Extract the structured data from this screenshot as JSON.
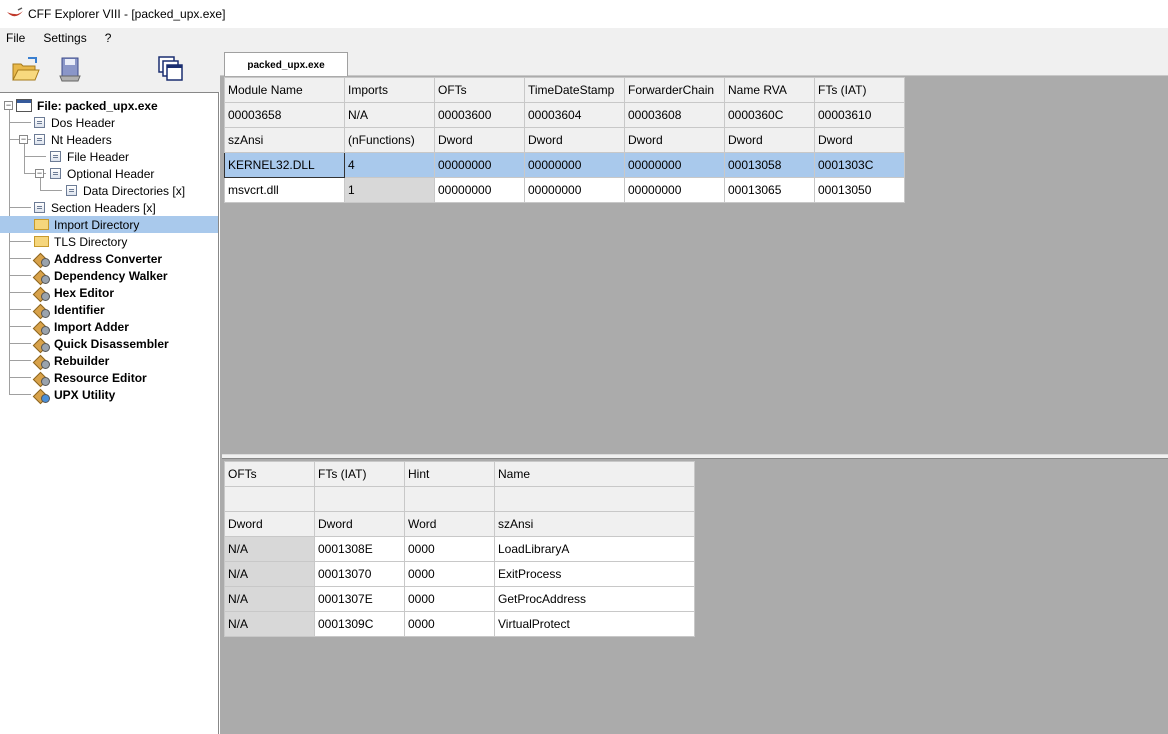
{
  "window": {
    "title": "CFF Explorer VIII - [packed_upx.exe]"
  },
  "menu": [
    "File",
    "Settings",
    "?"
  ],
  "tab": {
    "label": "packed_upx.exe"
  },
  "tree": [
    {
      "label": "File: packed_upx.exe",
      "bold": true,
      "icon": "file-icon",
      "indent": 0
    },
    {
      "label": "Dos Header",
      "icon": "doc-icon",
      "indent": 1
    },
    {
      "label": "Nt Headers",
      "icon": "doc-icon",
      "indent": 1
    },
    {
      "label": "File Header",
      "icon": "doc-icon",
      "indent": 2
    },
    {
      "label": "Optional Header",
      "icon": "doc-icon",
      "indent": 2
    },
    {
      "label": "Data Directories [x]",
      "icon": "doc-icon",
      "indent": 3
    },
    {
      "label": "Section Headers [x]",
      "icon": "doc-icon",
      "indent": 1
    },
    {
      "label": "Import Directory",
      "icon": "folder-icon",
      "indent": 1,
      "selected": true
    },
    {
      "label": "TLS Directory",
      "icon": "folder-icon",
      "indent": 1
    },
    {
      "label": "Address Converter",
      "icon": "tool-icon",
      "indent": 1,
      "bold": true
    },
    {
      "label": "Dependency Walker",
      "icon": "tool-icon",
      "indent": 1,
      "bold": true
    },
    {
      "label": "Hex Editor",
      "icon": "tool-icon",
      "indent": 1,
      "bold": true
    },
    {
      "label": "Identifier",
      "icon": "tool-icon",
      "indent": 1,
      "bold": true
    },
    {
      "label": "Import Adder",
      "icon": "tool-icon",
      "indent": 1,
      "bold": true
    },
    {
      "label": "Quick Disassembler",
      "icon": "tool-icon",
      "indent": 1,
      "bold": true
    },
    {
      "label": "Rebuilder",
      "icon": "tool-icon",
      "indent": 1,
      "bold": true
    },
    {
      "label": "Resource Editor",
      "icon": "tool-icon",
      "indent": 1,
      "bold": true
    },
    {
      "label": "UPX Utility",
      "icon": "upx-tool-icon",
      "indent": 1,
      "bold": true
    }
  ],
  "imports": {
    "header_rows": [
      [
        "Module Name",
        "Imports",
        "OFTs",
        "TimeDateStamp",
        "ForwarderChain",
        "Name RVA",
        "FTs (IAT)"
      ],
      [
        "00003658",
        "N/A",
        "00003600",
        "00003604",
        "00003608",
        "0000360C",
        "00003610"
      ],
      [
        "szAnsi",
        "(nFunctions)",
        "Dword",
        "Dword",
        "Dword",
        "Dword",
        "Dword"
      ]
    ],
    "rows": [
      [
        "KERNEL32.DLL",
        "4",
        "00000000",
        "00000000",
        "00000000",
        "00013058",
        "0001303C"
      ],
      [
        "msvcrt.dll",
        "1",
        "00000000",
        "00000000",
        "00000000",
        "00013065",
        "00013050"
      ]
    ],
    "selected_row": 0
  },
  "functions": {
    "header_rows": [
      [
        "OFTs",
        "FTs (IAT)",
        "Hint",
        "Name"
      ],
      [
        "",
        "",
        "",
        ""
      ],
      [
        "Dword",
        "Dword",
        "Word",
        "szAnsi"
      ]
    ],
    "rows": [
      [
        "N/A",
        "0001308E",
        "0000",
        "LoadLibraryA"
      ],
      [
        "N/A",
        "00013070",
        "0000",
        "ExitProcess"
      ],
      [
        "N/A",
        "0001307E",
        "0000",
        "GetProcAddress"
      ],
      [
        "N/A",
        "0001309C",
        "0000",
        "VirtualProtect"
      ]
    ]
  },
  "colors": {
    "selection": "#a9c9ec",
    "workspace": "#ababab",
    "chrome": "#f0f0f0"
  }
}
